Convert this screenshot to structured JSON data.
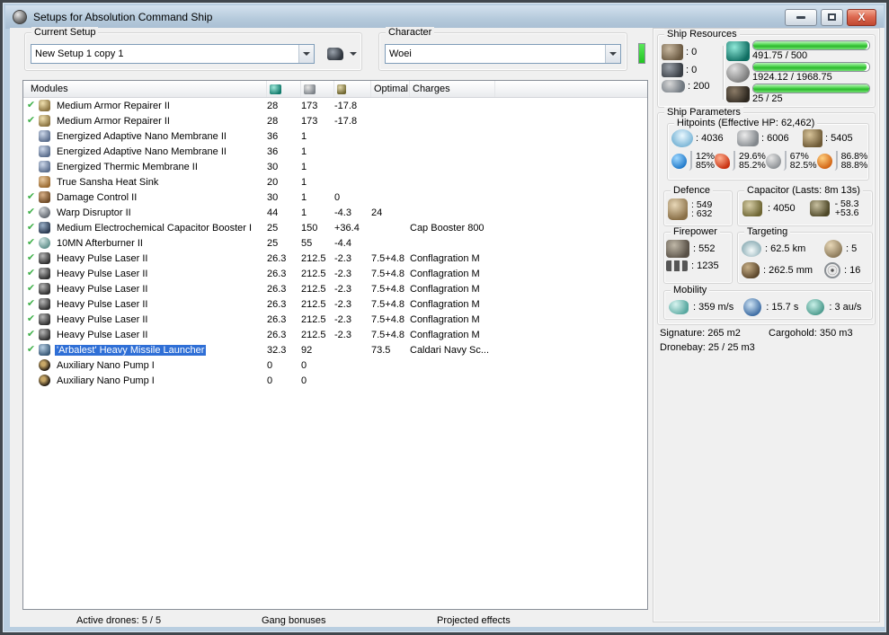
{
  "window": {
    "title": "Setups for Absolution Command Ship"
  },
  "setup": {
    "label": "Current Setup",
    "value": "New Setup 1 copy 1"
  },
  "character": {
    "label": "Character",
    "value": "Woei"
  },
  "table": {
    "modules_header": "Modules",
    "optimal_header": "Optimal",
    "charges_header": "Charges",
    "header_icons": [
      "cpu-icon",
      "powergrid-icon",
      "capacitor-icon"
    ],
    "rows": [
      {
        "fitted": true,
        "icon": "armor-repairer",
        "name": "Medium Armor Repairer II",
        "cpu": "28",
        "pg": "173",
        "cap": "-17.8",
        "optimal": "",
        "charges": "",
        "selected": false
      },
      {
        "fitted": true,
        "icon": "armor-repairer",
        "name": "Medium Armor Repairer II",
        "cpu": "28",
        "pg": "173",
        "cap": "-17.8",
        "optimal": "",
        "charges": "",
        "selected": false
      },
      {
        "fitted": false,
        "icon": "nano-membrane",
        "name": "Energized Adaptive Nano Membrane II",
        "cpu": "36",
        "pg": "1",
        "cap": "",
        "optimal": "",
        "charges": "",
        "selected": false
      },
      {
        "fitted": false,
        "icon": "nano-membrane",
        "name": "Energized Adaptive Nano Membrane II",
        "cpu": "36",
        "pg": "1",
        "cap": "",
        "optimal": "",
        "charges": "",
        "selected": false
      },
      {
        "fitted": false,
        "icon": "nano-membrane",
        "name": "Energized Thermic Membrane II",
        "cpu": "30",
        "pg": "1",
        "cap": "",
        "optimal": "",
        "charges": "",
        "selected": false
      },
      {
        "fitted": false,
        "icon": "heat-sink",
        "name": "True Sansha Heat Sink",
        "cpu": "20",
        "pg": "1",
        "cap": "",
        "optimal": "",
        "charges": "",
        "selected": false
      },
      {
        "fitted": true,
        "icon": "damage-control",
        "name": "Damage Control II",
        "cpu": "30",
        "pg": "1",
        "cap": "0",
        "optimal": "",
        "charges": "",
        "selected": false
      },
      {
        "fitted": true,
        "icon": "warp-disruptor",
        "name": "Warp Disruptor II",
        "cpu": "44",
        "pg": "1",
        "cap": "-4.3",
        "optimal": "24",
        "charges": "",
        "selected": false
      },
      {
        "fitted": true,
        "icon": "cap-booster",
        "name": "Medium Electrochemical Capacitor Booster I",
        "cpu": "25",
        "pg": "150",
        "cap": "+36.4",
        "optimal": "",
        "charges": "Cap Booster 800",
        "selected": false
      },
      {
        "fitted": true,
        "icon": "afterburner",
        "name": "10MN Afterburner II",
        "cpu": "25",
        "pg": "55",
        "cap": "-4.4",
        "optimal": "",
        "charges": "",
        "selected": false
      },
      {
        "fitted": true,
        "icon": "pulse-laser",
        "name": "Heavy Pulse Laser II",
        "cpu": "26.3",
        "pg": "212.5",
        "cap": "-2.3",
        "optimal": "7.5+4.8",
        "charges": "Conflagration M",
        "selected": false
      },
      {
        "fitted": true,
        "icon": "pulse-laser",
        "name": "Heavy Pulse Laser II",
        "cpu": "26.3",
        "pg": "212.5",
        "cap": "-2.3",
        "optimal": "7.5+4.8",
        "charges": "Conflagration M",
        "selected": false
      },
      {
        "fitted": true,
        "icon": "pulse-laser",
        "name": "Heavy Pulse Laser II",
        "cpu": "26.3",
        "pg": "212.5",
        "cap": "-2.3",
        "optimal": "7.5+4.8",
        "charges": "Conflagration M",
        "selected": false
      },
      {
        "fitted": true,
        "icon": "pulse-laser",
        "name": "Heavy Pulse Laser II",
        "cpu": "26.3",
        "pg": "212.5",
        "cap": "-2.3",
        "optimal": "7.5+4.8",
        "charges": "Conflagration M",
        "selected": false
      },
      {
        "fitted": true,
        "icon": "pulse-laser",
        "name": "Heavy Pulse Laser II",
        "cpu": "26.3",
        "pg": "212.5",
        "cap": "-2.3",
        "optimal": "7.5+4.8",
        "charges": "Conflagration M",
        "selected": false
      },
      {
        "fitted": true,
        "icon": "pulse-laser",
        "name": "Heavy Pulse Laser II",
        "cpu": "26.3",
        "pg": "212.5",
        "cap": "-2.3",
        "optimal": "7.5+4.8",
        "charges": "Conflagration M",
        "selected": false
      },
      {
        "fitted": true,
        "icon": "missile-launcher",
        "name": "'Arbalest' Heavy Missile Launcher",
        "cpu": "32.3",
        "pg": "92",
        "cap": "",
        "optimal": "73.5",
        "charges": "Caldari Navy Sc...",
        "selected": true
      },
      {
        "fitted": false,
        "icon": "nano-pump",
        "name": "Auxiliary Nano Pump I",
        "cpu": "0",
        "pg": "0",
        "cap": "",
        "optimal": "",
        "charges": "",
        "selected": false
      },
      {
        "fitted": false,
        "icon": "nano-pump",
        "name": "Auxiliary Nano Pump I",
        "cpu": "0",
        "pg": "0",
        "cap": "",
        "optimal": "",
        "charges": "",
        "selected": false
      }
    ]
  },
  "bottom_bar": {
    "active_drones": "Active drones: 5 / 5",
    "gang_bonuses": "Gang bonuses",
    "projected_effects": "Projected effects"
  },
  "resources": {
    "title": "Ship Resources",
    "turrets": ": 0",
    "launchers": ": 0",
    "calibration": ": 200",
    "cpu": {
      "text": "491.75 / 500",
      "pct": 98.4
    },
    "powergrid": {
      "text": "1924.12 / 1968.75",
      "pct": 97.7
    },
    "drones": {
      "text": "25 / 25",
      "pct": 100
    }
  },
  "parameters": {
    "title": "Ship Parameters",
    "hitpoints": {
      "title": "Hitpoints (Effective HP: 62,462)",
      "shield": ": 4036",
      "armor": ": 6006",
      "structure": ": 5405",
      "resists": [
        {
          "type": "em",
          "shield": "12%",
          "armor": "85%"
        },
        {
          "type": "thermal",
          "shield": "29.6%",
          "armor": "85.2%"
        },
        {
          "type": "kinetic",
          "shield": "67%",
          "armor": "82.5%"
        },
        {
          "type": "explosive",
          "shield": "86.8%",
          "armor": "88.8%"
        }
      ]
    },
    "defence": {
      "title": "Defence",
      "tank_passive": ": 549",
      "tank_active": ": 632"
    },
    "capacitor": {
      "title": "Capacitor (Lasts: 8m 13s)",
      "amount": ": 4050",
      "delta_out": "- 58.3",
      "delta_in": "+53.6"
    },
    "firepower": {
      "title": "Firepower",
      "dps": ": 552",
      "volley": ": 1235"
    },
    "targeting": {
      "title": "Targeting",
      "range": ": 62.5 km",
      "max_targets": ": 5",
      "scan_res": ": 262.5 mm",
      "sensor_strength": ": 16"
    },
    "mobility": {
      "title": "Mobility",
      "speed": ": 359 m/s",
      "align_time": ": 15.7 s",
      "warp_speed": ": 3 au/s"
    },
    "signature": "Signature: 265 m2",
    "cargohold": "Cargohold: 350 m3",
    "dronebay": "Dronebay: 25 / 25 m3"
  }
}
